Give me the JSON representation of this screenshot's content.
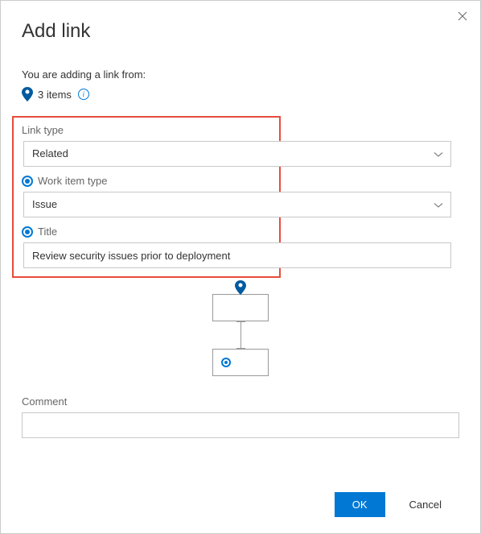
{
  "dialog": {
    "title": "Add link",
    "subtext": "You are adding a link from:",
    "items_count_label": "3 items"
  },
  "fields": {
    "link_type": {
      "label": "Link type",
      "value": "Related"
    },
    "work_item_type": {
      "label": "Work item type",
      "value": "Issue"
    },
    "title": {
      "label": "Title",
      "value": "Review security issues prior to deployment"
    }
  },
  "comment": {
    "label": "Comment",
    "value": ""
  },
  "buttons": {
    "ok": "OK",
    "cancel": "Cancel"
  }
}
